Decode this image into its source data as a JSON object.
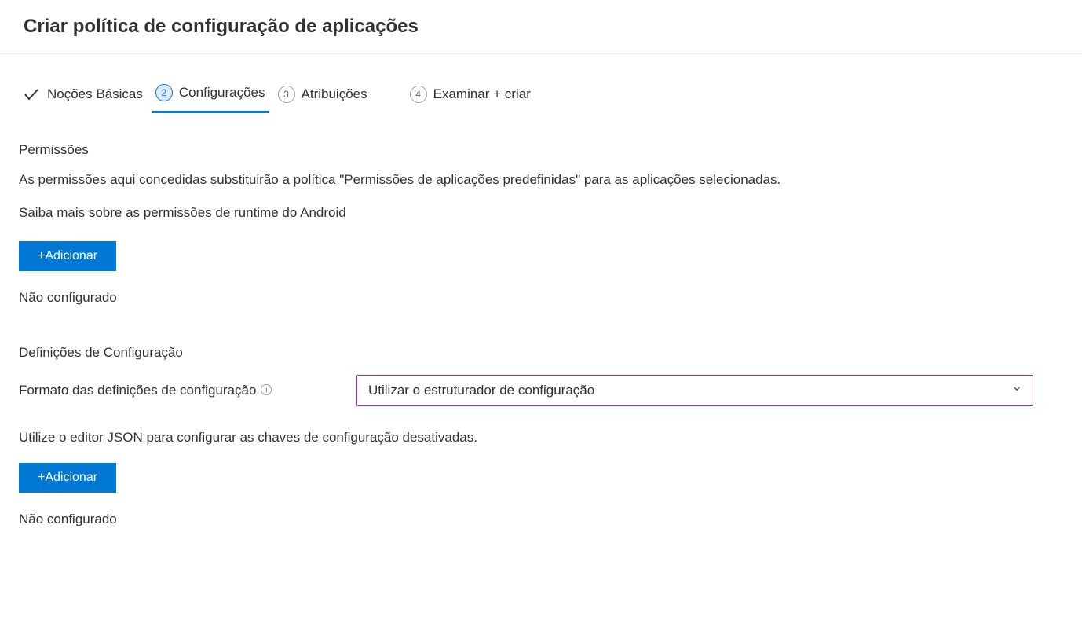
{
  "header": {
    "title": "Criar política de configuração de aplicações"
  },
  "wizard": {
    "step1_label": "Noções Básicas",
    "step2_number": "2",
    "step2_label": "Configurações",
    "step3_number": "3",
    "step3_label": "Atribuições",
    "step4_number": "4",
    "step4_label": "Examinar + criar"
  },
  "permissions": {
    "heading": "Permissões",
    "description": "As permissões aqui concedidas substituirão a política \"Permissões de aplicações predefinidas\" para as aplicações selecionadas.",
    "learn_more": "Saiba mais sobre as permissões de runtime do Android",
    "add_button": "+Adicionar",
    "status": "Não configurado"
  },
  "configuration": {
    "heading": "Definições de Configuração",
    "format_label": "Formato das definições de configuração",
    "format_value": "Utilizar o estruturador de configuração",
    "json_hint": "Utilize o editor JSON para configurar as chaves de configuração desativadas.",
    "add_button": "+Adicionar",
    "status": "Não configurado"
  }
}
